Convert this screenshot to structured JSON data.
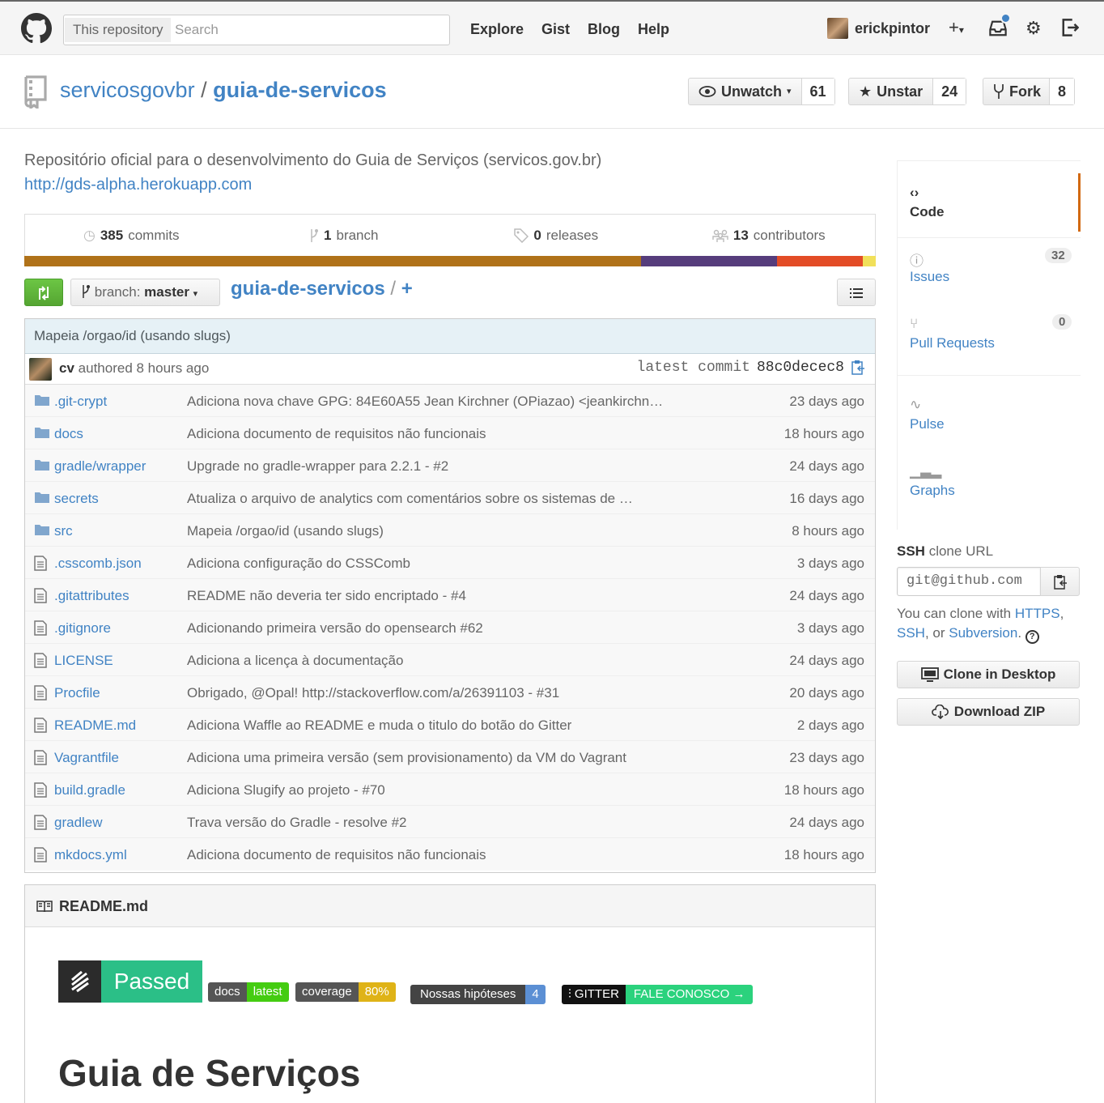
{
  "header": {
    "search_scope": "This repository",
    "search_placeholder": "Search",
    "nav": [
      "Explore",
      "Gist",
      "Blog",
      "Help"
    ],
    "username": "erickpintor",
    "plus_label": "+",
    "icons": [
      "octocat-logo-icon",
      "plus-icon",
      "inbox-icon",
      "gear-icon",
      "sign-out-icon"
    ]
  },
  "repo": {
    "owner": "servicosgovbr",
    "separator": "/",
    "name": "guia-de-servicos",
    "watch_label": "Unwatch",
    "watch_count": "61",
    "star_label": "Unstar",
    "star_count": "24",
    "fork_label": "Fork",
    "fork_count": "8",
    "description": "Repositório oficial para o desenvolvimento do Guia de Serviços (servicos.gov.br)",
    "homepage": "http://gds-alpha.herokuapp.com"
  },
  "summary": [
    {
      "num": "385",
      "label": "commits",
      "icon": "history-icon"
    },
    {
      "num": "1",
      "label": "branch",
      "icon": "branch-icon"
    },
    {
      "num": "0",
      "label": "releases",
      "icon": "tag-icon"
    },
    {
      "num": "13",
      "label": "contributors",
      "icon": "organization-icon"
    }
  ],
  "languages": [
    {
      "share": 72.4,
      "color": "#b07219"
    },
    {
      "share": 16.0,
      "color": "#563d7c"
    },
    {
      "share": 10.1,
      "color": "#e34c26"
    },
    {
      "share": 1.5,
      "color": "#f1e05a"
    }
  ],
  "filenav": {
    "branch_prefix": "branch:",
    "branch": "master",
    "root": "guia-de-servicos",
    "slash": "/",
    "plus": "+"
  },
  "latest_commit": {
    "message": "Mapeia /orgao/id (usando slugs)",
    "author": "cv",
    "authored_text": "authored 8 hours ago",
    "sha_label": "latest commit",
    "sha": "88c0decec8"
  },
  "files": [
    {
      "type": "dir",
      "name": ".git-crypt",
      "message": "Adiciona nova chave GPG: 84E60A55 Jean Kirchner (OPiazao) <jeankirchn…",
      "age": "23 days ago"
    },
    {
      "type": "dir",
      "name": "docs",
      "message": "Adiciona documento de requisitos não funcionais",
      "age": "18 hours ago"
    },
    {
      "type": "dir",
      "name": "gradle/wrapper",
      "message": "Upgrade no gradle-wrapper para 2.2.1 - #2",
      "age": "24 days ago"
    },
    {
      "type": "dir",
      "name": "secrets",
      "message": "Atualiza o arquivo de analytics com comentários sobre os sistemas de …",
      "age": "16 days ago"
    },
    {
      "type": "dir",
      "name": "src",
      "message": "Mapeia /orgao/id (usando slugs)",
      "age": "8 hours ago"
    },
    {
      "type": "file",
      "name": ".csscomb.json",
      "message": "Adiciona configuração do CSSComb",
      "age": "3 days ago"
    },
    {
      "type": "file",
      "name": ".gitattributes",
      "message": "README não deveria ter sido encriptado - #4",
      "age": "24 days ago"
    },
    {
      "type": "file",
      "name": ".gitignore",
      "message": "Adicionando primeira versão do opensearch #62",
      "age": "3 days ago"
    },
    {
      "type": "file",
      "name": "LICENSE",
      "message": "Adiciona a licença à documentação",
      "age": "24 days ago"
    },
    {
      "type": "file",
      "name": "Procfile",
      "message": "Obrigado, @Opal! http://stackoverflow.com/a/26391103 - #31",
      "age": "20 days ago"
    },
    {
      "type": "file",
      "name": "README.md",
      "message": "Adiciona Waffle ao README e muda o titulo do botão do Gitter",
      "age": "2 days ago"
    },
    {
      "type": "file",
      "name": "Vagrantfile",
      "message": "Adiciona uma primeira versão (sem provisionamento) da VM do Vagrant",
      "age": "23 days ago"
    },
    {
      "type": "file",
      "name": "build.gradle",
      "message": "Adiciona Slugify ao projeto - #70",
      "age": "18 hours ago"
    },
    {
      "type": "file",
      "name": "gradlew",
      "message": "Trava versão do Gradle - resolve #2",
      "age": "24 days ago"
    },
    {
      "type": "file",
      "name": "mkdocs.yml",
      "message": "Adiciona documento de requisitos não funcionais",
      "age": "18 hours ago"
    }
  ],
  "readme": {
    "title": "README.md",
    "badges": {
      "passed": "Passed",
      "docs_l": "docs",
      "docs_r": "latest",
      "cov_l": "coverage",
      "cov_r": "80%",
      "hyp_l": "Nossas hipóteses",
      "hyp_r": "4",
      "gitter_l": "GITTER",
      "gitter_r": "FALE CONOSCO →"
    },
    "heading": "Guia de Serviços"
  },
  "sidebar": {
    "code": "Code",
    "issues": "Issues",
    "issues_count": "32",
    "pulls": "Pull Requests",
    "pulls_count": "0",
    "pulse": "Pulse",
    "graphs": "Graphs",
    "ssh_bold": "SSH",
    "ssh_rest": "clone URL",
    "ssh_url": "git@github.com",
    "help_prefix": "You can clone with",
    "https": "HTTPS",
    "comma": ",",
    "ssh": "SSH",
    "or": ", or",
    "subversion": "Subversion",
    "period": ".",
    "clone_desktop": "Clone in Desktop",
    "download_zip": "Download ZIP"
  }
}
